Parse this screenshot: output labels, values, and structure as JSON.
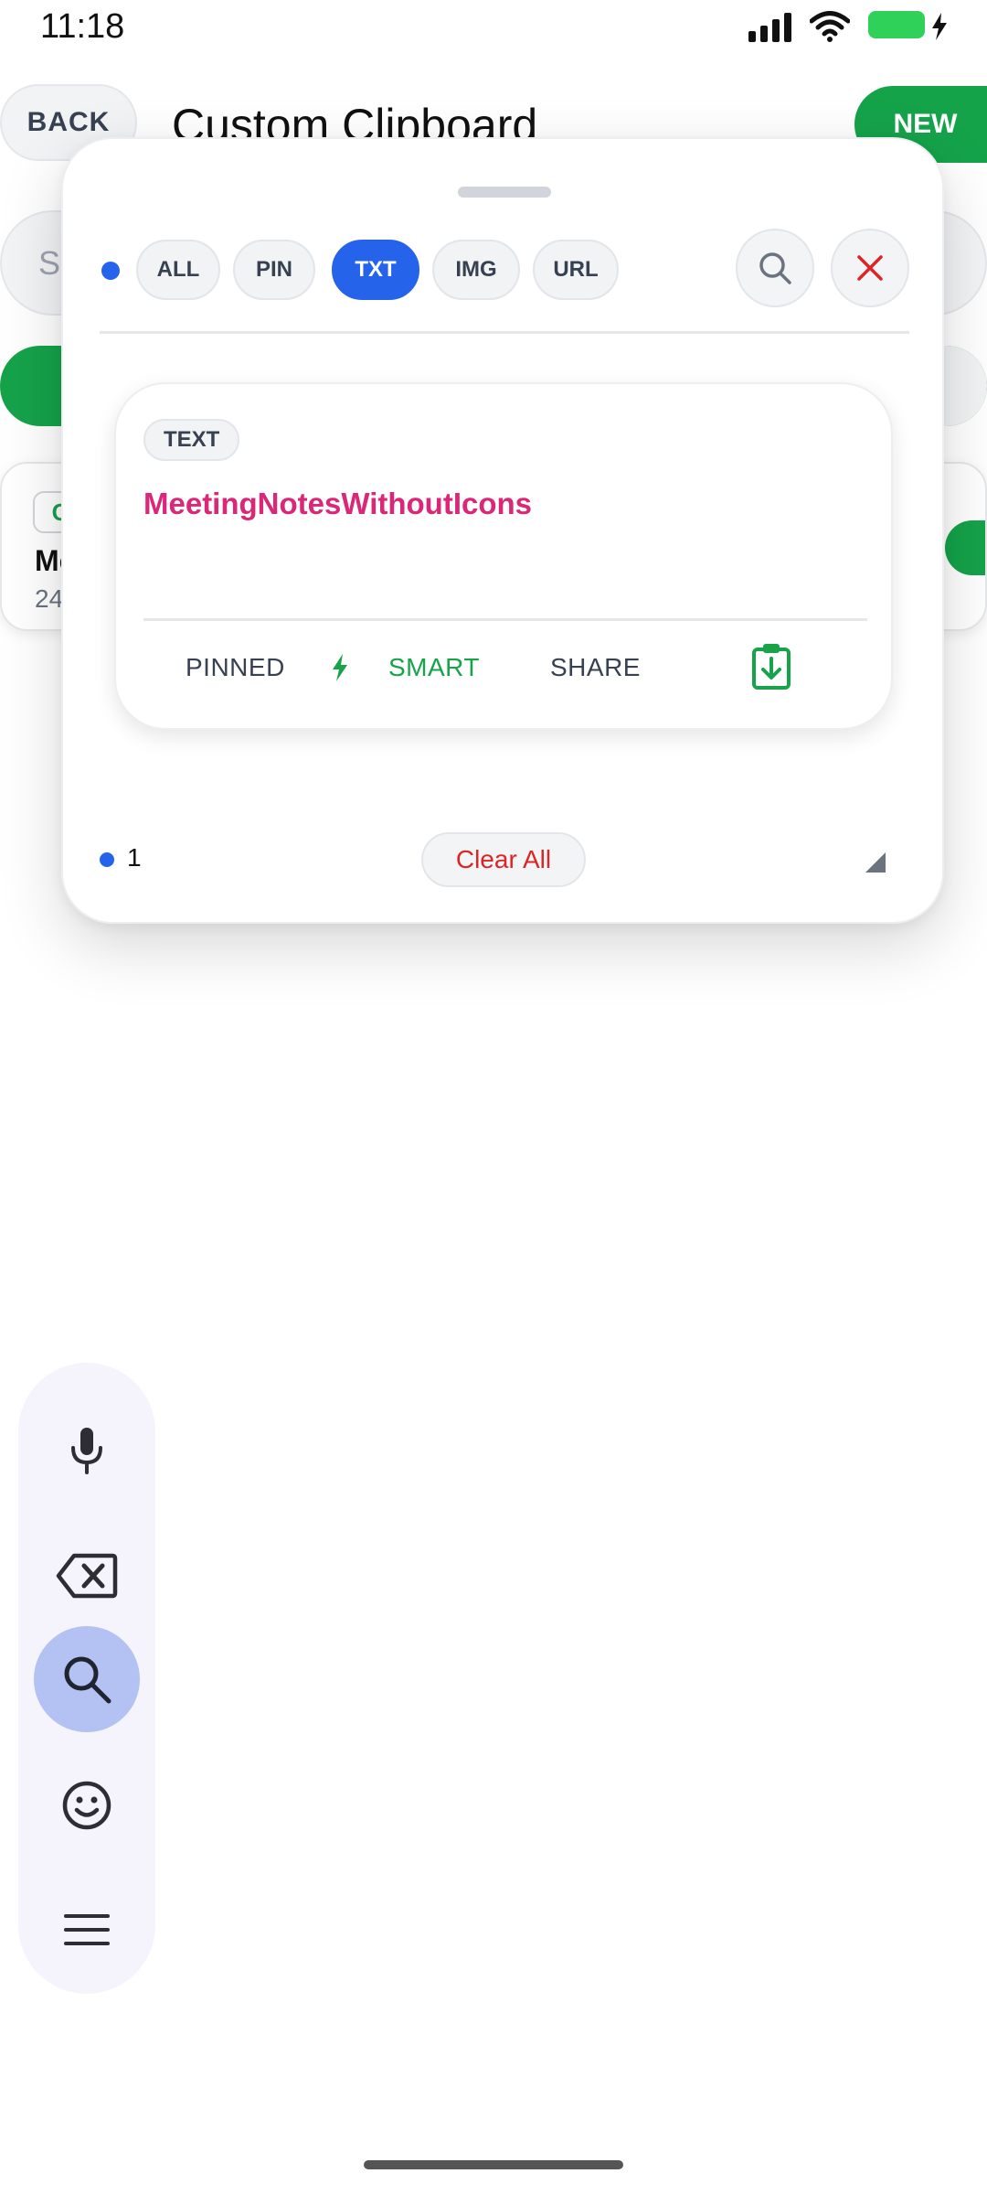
{
  "status_bar": {
    "time": "11:18"
  },
  "background_app": {
    "back_label": "BACK",
    "title": "Custom Clipboard",
    "new_label": "NEW",
    "search_placeholder_fragment": "Se",
    "card": {
      "badge": "C",
      "title_fragment": "Me",
      "meta_fragment": "24"
    }
  },
  "panel": {
    "filters": [
      {
        "label": "ALL",
        "active": false
      },
      {
        "label": "PIN",
        "active": false
      },
      {
        "label": "TXT",
        "active": true
      },
      {
        "label": "IMG",
        "active": false
      },
      {
        "label": "URL",
        "active": false
      }
    ],
    "clip": {
      "type_label": "TEXT",
      "text": "MeetingNotesWithoutIcons",
      "actions": {
        "pinned": "PINNED",
        "smart": "SMART",
        "share": "SHARE"
      }
    },
    "footer": {
      "count": "1",
      "clear_all": "Clear All"
    }
  },
  "floating_toolbar": {
    "items": [
      "mic-icon",
      "backspace-icon",
      "search-icon",
      "emoji-icon",
      "menu-icon"
    ],
    "active": "search-icon"
  },
  "colors": {
    "accent_blue": "#2563eb",
    "accent_green": "#15a34a",
    "clip_text": "#db2777",
    "danger": "#dc2626"
  }
}
